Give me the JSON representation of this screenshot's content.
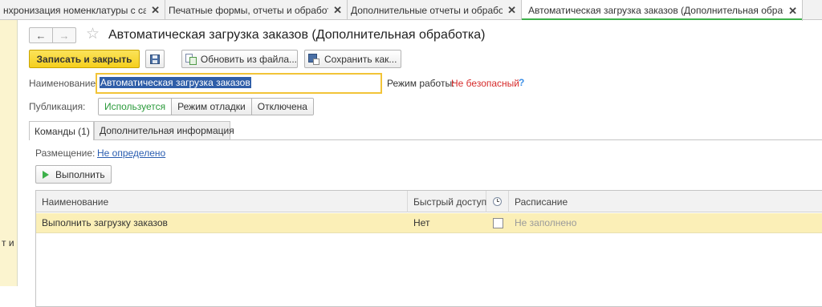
{
  "tabs": [
    {
      "label": "нхронизация номенклатуры с сайта"
    },
    {
      "label": "Печатные формы, отчеты и обработки"
    },
    {
      "label": "Дополнительные отчеты и обработки"
    },
    {
      "label": "Автоматическая загрузка заказов (Дополнительная обработка)"
    }
  ],
  "left_panel": {
    "text": "т и"
  },
  "form": {
    "title": "Автоматическая загрузка заказов (Дополнительная обработка)",
    "toolbar": {
      "save_close": "Записать и закрыть",
      "refresh": "Обновить из файла...",
      "save_as": "Сохранить как..."
    },
    "name_label": "Наименование:",
    "name_value": "Автоматическая загрузка заказов",
    "mode_label": "Режим работы:",
    "mode_value": "Не безопасный",
    "help": "?",
    "publication_label": "Публикация:",
    "publication_options": [
      "Используется",
      "Режим отладки",
      "Отключена"
    ],
    "form_tabs": [
      "Команды (1)",
      "Дополнительная информация"
    ],
    "placement_label": "Размещение:",
    "placement_value": "Не определено",
    "run_button": "Выполнить",
    "table": {
      "columns": [
        "Наименование",
        "Быстрый доступ",
        "",
        "Расписание"
      ],
      "rows": [
        {
          "name": "Выполнить загрузку заказов",
          "quick_access": "Нет",
          "schedule": "Не заполнено"
        }
      ]
    }
  },
  "colors": {
    "primary_button": "#f5cf1e",
    "active_tab_accent": "#3db04a",
    "selected_row": "#fbefb7",
    "danger_text": "#d62b2b",
    "link": "#2a5db0"
  }
}
